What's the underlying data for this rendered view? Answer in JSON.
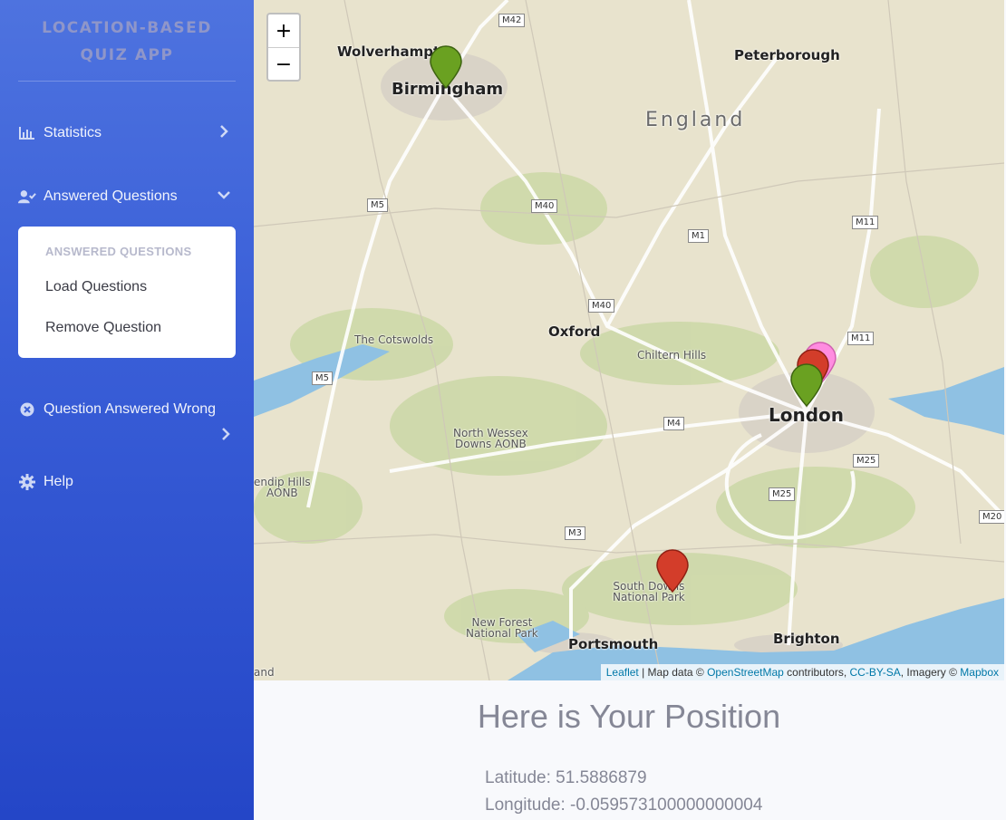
{
  "sidebar": {
    "brand": "LOCATION-BASED QUIZ APP",
    "items": [
      {
        "label": "Statistics",
        "icon": "bar-chart-icon"
      },
      {
        "label": "Answered Questions",
        "icon": "user-check-icon"
      },
      {
        "label": "Question Answered Wrong",
        "icon": "times-circle-icon"
      },
      {
        "label": "Help",
        "icon": "cog-icon"
      }
    ],
    "collapse": {
      "header": "ANSWERED QUESTIONS",
      "items": [
        "Load Questions",
        "Remove Question"
      ]
    }
  },
  "map": {
    "zoom_in": "+",
    "zoom_out": "−",
    "labels": {
      "wolverhampton": "Wolverhampt",
      "birmingham": "Birmingham",
      "peterborough": "Peterborough",
      "england": "England",
      "oxford": "Oxford",
      "cotswolds": "The Cotswolds",
      "chiltern": "Chiltern Hills",
      "london": "London",
      "north_wessex": "North Wessex\nDowns AONB",
      "mendip": "endip Hills\nAONB",
      "south_downs": "South Downs\nNational Park",
      "new_forest": "New Forest\nNational Park",
      "portsmouth": "Portsmouth",
      "brighton": "Brighton",
      "land_edge": "and"
    },
    "roads": [
      "M42",
      "M5",
      "M40",
      "M1",
      "M11",
      "M40",
      "M11",
      "M5",
      "M4",
      "M25",
      "M25",
      "M3",
      "M20"
    ],
    "markers": [
      {
        "color": "#6aa121",
        "place": "Birmingham"
      },
      {
        "color": "#ff8ce0",
        "place": "London"
      },
      {
        "color": "#d33d2a",
        "place": "London"
      },
      {
        "color": "#6aa121",
        "place": "London"
      },
      {
        "color": "#d33d2a",
        "place": "South Downs"
      }
    ],
    "attribution": {
      "leaflet": "Leaflet",
      "sep1": " | Map data © ",
      "osm": "OpenStreetMap",
      "sep2": " contributors, ",
      "license": "CC-BY-SA",
      "sep3": ", Imagery © ",
      "mapbox": "Mapbox"
    }
  },
  "position": {
    "title": "Here is Your Position",
    "latitude": "Latitude: 51.5886879",
    "longitude": "Longitude: -0.059573100000000004"
  }
}
